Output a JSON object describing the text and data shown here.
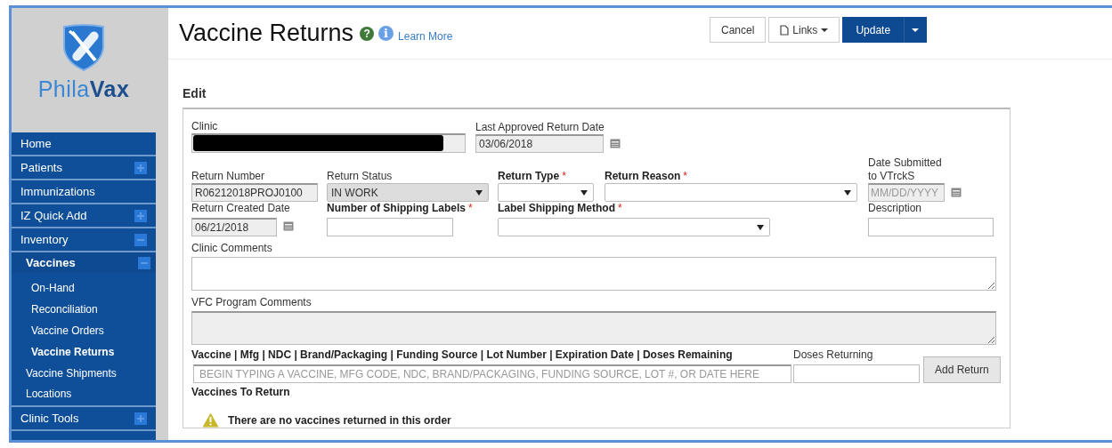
{
  "sidebar": {
    "logo": "Phila**Vax**",
    "items": [
      {
        "label": "Home",
        "selected": false
      },
      {
        "label": "Patients",
        "selected": false,
        "expanded": false
      },
      {
        "label": "Immunizations",
        "selected": false
      },
      {
        "label": "IZ Quick Add",
        "selected": false,
        "expanded": false
      },
      {
        "label": "Inventory",
        "selected": false,
        "expanded": true,
        "children": [
          {
            "label": "Vaccines",
            "selected": true,
            "expanded": true,
            "children": [
              {
                "label": "On-Hand",
                "selected": false
              },
              {
                "label": "Reconciliation",
                "selected": false
              },
              {
                "label": "Vaccine Orders",
                "selected": false
              },
              {
                "label": "Vaccine Returns",
                "selected": true
              }
            ]
          },
          {
            "label": "Vaccine Shipments",
            "selected": false
          },
          {
            "label": "Locations",
            "selected": false
          }
        ]
      },
      {
        "label": "Clinic Tools",
        "selected": false,
        "expanded": false
      }
    ]
  },
  "header": {
    "title": "Vaccine Returns",
    "help_icon": "?",
    "info_icon": "i",
    "learn_more": "Learn More",
    "buttons": [
      {
        "label": "Cancel",
        "kind": "plain"
      },
      {
        "label": "Links",
        "kind": "menu"
      },
      {
        "label": "Update",
        "kind": "split"
      }
    ]
  },
  "form": {
    "title": "Edit",
    "groups": [
      {
        "fields": [
          {
            "label": "Clinic",
            "kind": "redacted",
            "readonly": true,
            "strong": false
          },
          {
            "label": "Last Approved Return Date",
            "kind": "date",
            "value": "03/06/2018",
            "readonly": true,
            "strong": false
          }
        ]
      },
      {
        "fields": [
          {
            "label": "Return Number",
            "kind": "text",
            "value": "R06212018PROJ0100",
            "readonly": true,
            "strong": false
          },
          {
            "label": "Return Status",
            "kind": "select",
            "value": "IN WORK",
            "readonly": true,
            "strong": false
          },
          {
            "label": "Return Type",
            "kind": "select",
            "readonly": false,
            "required_mark": "*",
            "strong": true
          },
          {
            "label": "Return Reason",
            "kind": "select",
            "readonly": false,
            "required_mark": "*",
            "strong": true
          },
          {
            "label": "Date Submitted to VTrckS",
            "kind": "date",
            "placeholder": "MM/DD/YYYY",
            "readonly": true,
            "strong": false
          }
        ]
      },
      {
        "fields": [
          {
            "label": "Return Created Date",
            "kind": "date",
            "value": "06/21/2018",
            "readonly": true,
            "strong": false
          },
          {
            "label": "Number of Shipping Labels",
            "kind": "text",
            "readonly": false,
            "required_mark": "*",
            "strong": true
          },
          {
            "label": "Label Shipping Method",
            "kind": "select",
            "readonly": false,
            "required_mark": "*",
            "strong": true
          },
          {
            "label": "Description",
            "kind": "text",
            "readonly": false,
            "strong": false
          }
        ]
      },
      {
        "fields": [
          {
            "label": "Clinic Comments",
            "kind": "textarea",
            "readonly": false,
            "strong": false
          }
        ]
      },
      {
        "fields": [
          {
            "label": "VFC Program Comments",
            "kind": "textarea",
            "readonly": true,
            "strong": false
          }
        ]
      },
      {
        "fields": [
          {
            "label": "Vaccine | Mfg | NDC | Brand/Packaging | Funding Source | Lot Number | Expiration Date | Doses Remaining",
            "kind": "text",
            "placeholder": "BEGIN TYPING A VACCINE, MFG CODE, NDC, BRAND/PACKAGING, FUNDING SOURCE, LOT #, OR DATE HERE",
            "readonly": false,
            "strong": true
          },
          {
            "label": "Doses Returning",
            "kind": "text",
            "readonly": false,
            "strong": false
          },
          {
            "label": "Add Return",
            "kind": "button"
          }
        ]
      }
    ],
    "returns_title": "Vaccines To Return",
    "empty_message": "There are no vaccines returned in this order"
  }
}
